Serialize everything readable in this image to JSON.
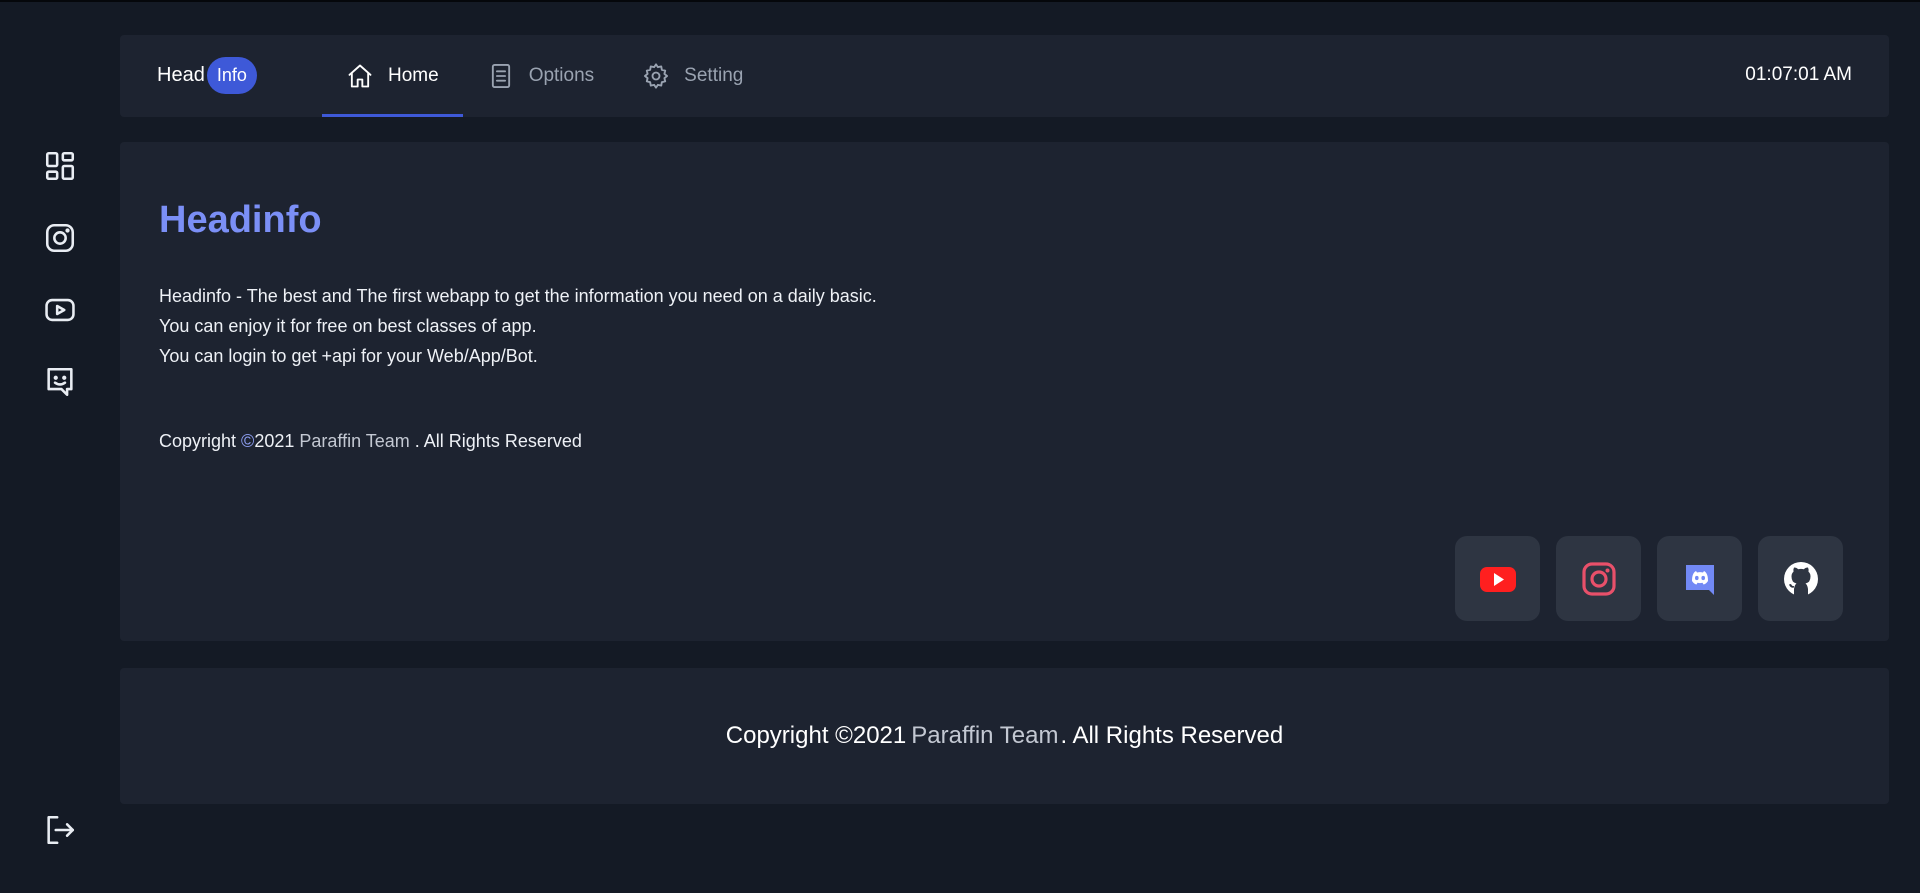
{
  "brand": {
    "head": "Head",
    "badge": "Info"
  },
  "nav": [
    {
      "label": "Home",
      "icon": "home-icon",
      "active": true
    },
    {
      "label": "Options",
      "icon": "document-icon",
      "active": false
    },
    {
      "label": "Setting",
      "icon": "gear-icon",
      "active": false
    }
  ],
  "clock": "01:07:01 AM",
  "sidebar": {
    "items": [
      {
        "icon": "dashboard-icon"
      },
      {
        "icon": "instagram-icon"
      },
      {
        "icon": "youtube-icon"
      },
      {
        "icon": "chat-bot-icon"
      }
    ],
    "logout_icon": "logout-icon"
  },
  "main": {
    "title": "Headinfo",
    "lines": [
      "Headinfo - The best and The first webapp to get the information you need on a daily basic.",
      "You can enjoy it for free on best classes of app.",
      "You can login to get +api for your Web/App/Bot."
    ],
    "copyright": {
      "prefix": "Copyright ",
      "symbol": "©",
      "year": "2021",
      "team": "Paraffin Team",
      "suffix": " . All Rights Reserved"
    },
    "socials": [
      {
        "icon": "youtube-icon",
        "color": "#ff1f1f"
      },
      {
        "icon": "instagram-icon",
        "color": "#e8506a"
      },
      {
        "icon": "discord-icon",
        "color": "#7289f5"
      },
      {
        "icon": "github-icon",
        "color": "#ffffff"
      }
    ]
  },
  "footer": {
    "prefix": "Copyright ©2021",
    "team": "Paraffin Team",
    "suffix": ". All Rights Reserved"
  },
  "colors": {
    "background": "#141a25",
    "card": "#1d2330",
    "accent": "#3e59d8",
    "title": "#7b8ff6",
    "social_bg": "#2e3542"
  }
}
